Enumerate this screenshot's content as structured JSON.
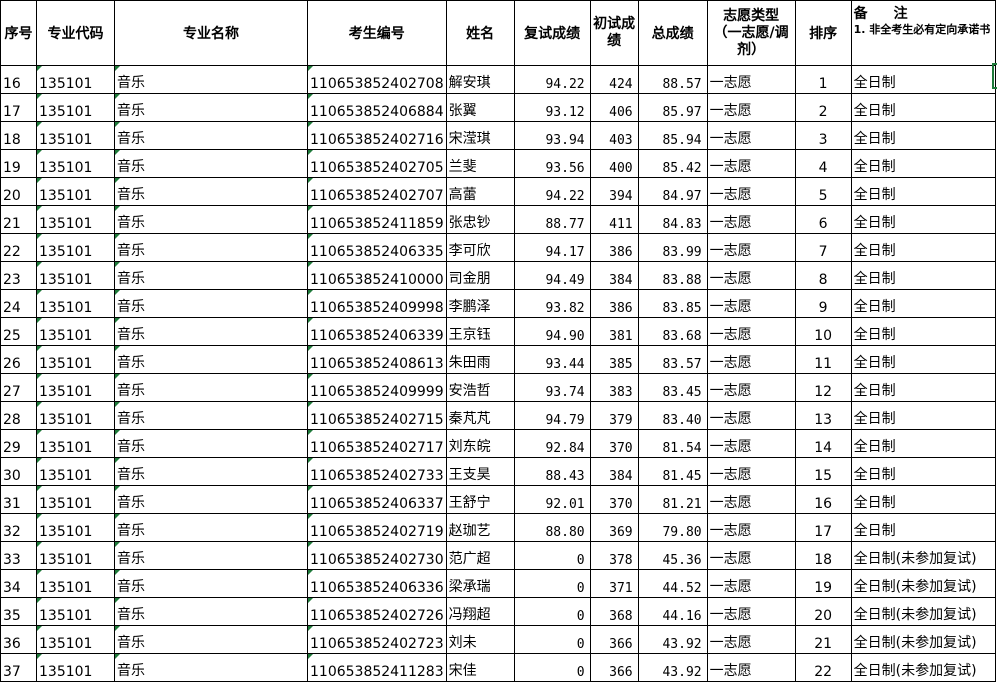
{
  "headers": {
    "seq": "序号",
    "code": "专业代码",
    "major": "专业名称",
    "exam_no": "考生编号",
    "name": "姓名",
    "retest": "复试成绩",
    "initial": "初试成绩",
    "total": "总成绩",
    "choice": "志愿类型（一志愿/调剂）",
    "rank": "排序",
    "note_title": "备　注",
    "note_sub": "1. 非全考生必有定向承诺书"
  },
  "rows": [
    {
      "seq": "16",
      "code": "135101",
      "major": "音乐",
      "exam_no": "110653852402708",
      "name": "解安琪",
      "retest": "94.22",
      "initial": "424",
      "total": "88.57",
      "choice": "一志愿",
      "rank": "1",
      "note": "全日制"
    },
    {
      "seq": "17",
      "code": "135101",
      "major": "音乐",
      "exam_no": "110653852406884",
      "name": "张翼",
      "retest": "93.12",
      "initial": "406",
      "total": "85.97",
      "choice": "一志愿",
      "rank": "2",
      "note": "全日制"
    },
    {
      "seq": "18",
      "code": "135101",
      "major": "音乐",
      "exam_no": "110653852402716",
      "name": "宋滢琪",
      "retest": "93.94",
      "initial": "403",
      "total": "85.94",
      "choice": "一志愿",
      "rank": "3",
      "note": "全日制"
    },
    {
      "seq": "19",
      "code": "135101",
      "major": "音乐",
      "exam_no": "110653852402705",
      "name": "兰斐",
      "retest": "93.56",
      "initial": "400",
      "total": "85.42",
      "choice": "一志愿",
      "rank": "4",
      "note": "全日制"
    },
    {
      "seq": "20",
      "code": "135101",
      "major": "音乐",
      "exam_no": "110653852402707",
      "name": "高蕾",
      "retest": "94.22",
      "initial": "394",
      "total": "84.97",
      "choice": "一志愿",
      "rank": "5",
      "note": "全日制"
    },
    {
      "seq": "21",
      "code": "135101",
      "major": "音乐",
      "exam_no": "110653852411859",
      "name": "张忠钞",
      "retest": "88.77",
      "initial": "411",
      "total": "84.83",
      "choice": "一志愿",
      "rank": "6",
      "note": "全日制"
    },
    {
      "seq": "22",
      "code": "135101",
      "major": "音乐",
      "exam_no": "110653852406335",
      "name": "李可欣",
      "retest": "94.17",
      "initial": "386",
      "total": "83.99",
      "choice": "一志愿",
      "rank": "7",
      "note": "全日制"
    },
    {
      "seq": "23",
      "code": "135101",
      "major": "音乐",
      "exam_no": "110653852410000",
      "name": "司金朋",
      "retest": "94.49",
      "initial": "384",
      "total": "83.88",
      "choice": "一志愿",
      "rank": "8",
      "note": "全日制"
    },
    {
      "seq": "24",
      "code": "135101",
      "major": "音乐",
      "exam_no": "110653852409998",
      "name": "李鹏泽",
      "retest": "93.82",
      "initial": "386",
      "total": "83.85",
      "choice": "一志愿",
      "rank": "9",
      "note": "全日制"
    },
    {
      "seq": "25",
      "code": "135101",
      "major": "音乐",
      "exam_no": "110653852406339",
      "name": "王京钰",
      "retest": "94.90",
      "initial": "381",
      "total": "83.68",
      "choice": "一志愿",
      "rank": "10",
      "note": "全日制"
    },
    {
      "seq": "26",
      "code": "135101",
      "major": "音乐",
      "exam_no": "110653852408613",
      "name": "朱田雨",
      "retest": "93.44",
      "initial": "385",
      "total": "83.57",
      "choice": "一志愿",
      "rank": "11",
      "note": "全日制"
    },
    {
      "seq": "27",
      "code": "135101",
      "major": "音乐",
      "exam_no": "110653852409999",
      "name": "安浩哲",
      "retest": "93.74",
      "initial": "383",
      "total": "83.45",
      "choice": "一志愿",
      "rank": "12",
      "note": "全日制"
    },
    {
      "seq": "28",
      "code": "135101",
      "major": "音乐",
      "exam_no": "110653852402715",
      "name": "秦芃芃",
      "retest": "94.79",
      "initial": "379",
      "total": "83.40",
      "choice": "一志愿",
      "rank": "13",
      "note": "全日制"
    },
    {
      "seq": "29",
      "code": "135101",
      "major": "音乐",
      "exam_no": "110653852402717",
      "name": "刘东皖",
      "retest": "92.84",
      "initial": "370",
      "total": "81.54",
      "choice": "一志愿",
      "rank": "14",
      "note": "全日制"
    },
    {
      "seq": "30",
      "code": "135101",
      "major": "音乐",
      "exam_no": "110653852402733",
      "name": "王支昊",
      "retest": "88.43",
      "initial": "384",
      "total": "81.45",
      "choice": "一志愿",
      "rank": "15",
      "note": "全日制"
    },
    {
      "seq": "31",
      "code": "135101",
      "major": "音乐",
      "exam_no": "110653852406337",
      "name": "王舒宁",
      "retest": "92.01",
      "initial": "370",
      "total": "81.21",
      "choice": "一志愿",
      "rank": "16",
      "note": "全日制"
    },
    {
      "seq": "32",
      "code": "135101",
      "major": "音乐",
      "exam_no": "110653852402719",
      "name": "赵珈艺",
      "retest": "88.80",
      "initial": "369",
      "total": "79.80",
      "choice": "一志愿",
      "rank": "17",
      "note": "全日制"
    },
    {
      "seq": "33",
      "code": "135101",
      "major": "音乐",
      "exam_no": "110653852402730",
      "name": "范广超",
      "retest": "0",
      "initial": "378",
      "total": "45.36",
      "choice": "一志愿",
      "rank": "18",
      "note": "全日制(未参加复试)"
    },
    {
      "seq": "34",
      "code": "135101",
      "major": "音乐",
      "exam_no": "110653852406336",
      "name": "梁承瑞",
      "retest": "0",
      "initial": "371",
      "total": "44.52",
      "choice": "一志愿",
      "rank": "19",
      "note": "全日制(未参加复试)"
    },
    {
      "seq": "35",
      "code": "135101",
      "major": "音乐",
      "exam_no": "110653852402726",
      "name": "冯翔超",
      "retest": "0",
      "initial": "368",
      "total": "44.16",
      "choice": "一志愿",
      "rank": "20",
      "note": "全日制(未参加复试)"
    },
    {
      "seq": "36",
      "code": "135101",
      "major": "音乐",
      "exam_no": "110653852402723",
      "name": "刘未",
      "retest": "0",
      "initial": "366",
      "total": "43.92",
      "choice": "一志愿",
      "rank": "21",
      "note": "全日制(未参加复试)"
    },
    {
      "seq": "37",
      "code": "135101",
      "major": "音乐",
      "exam_no": "110653852411283",
      "name": "宋佳",
      "retest": "0",
      "initial": "366",
      "total": "43.92",
      "choice": "一志愿",
      "rank": "22",
      "note": "全日制(未参加复试)"
    }
  ]
}
